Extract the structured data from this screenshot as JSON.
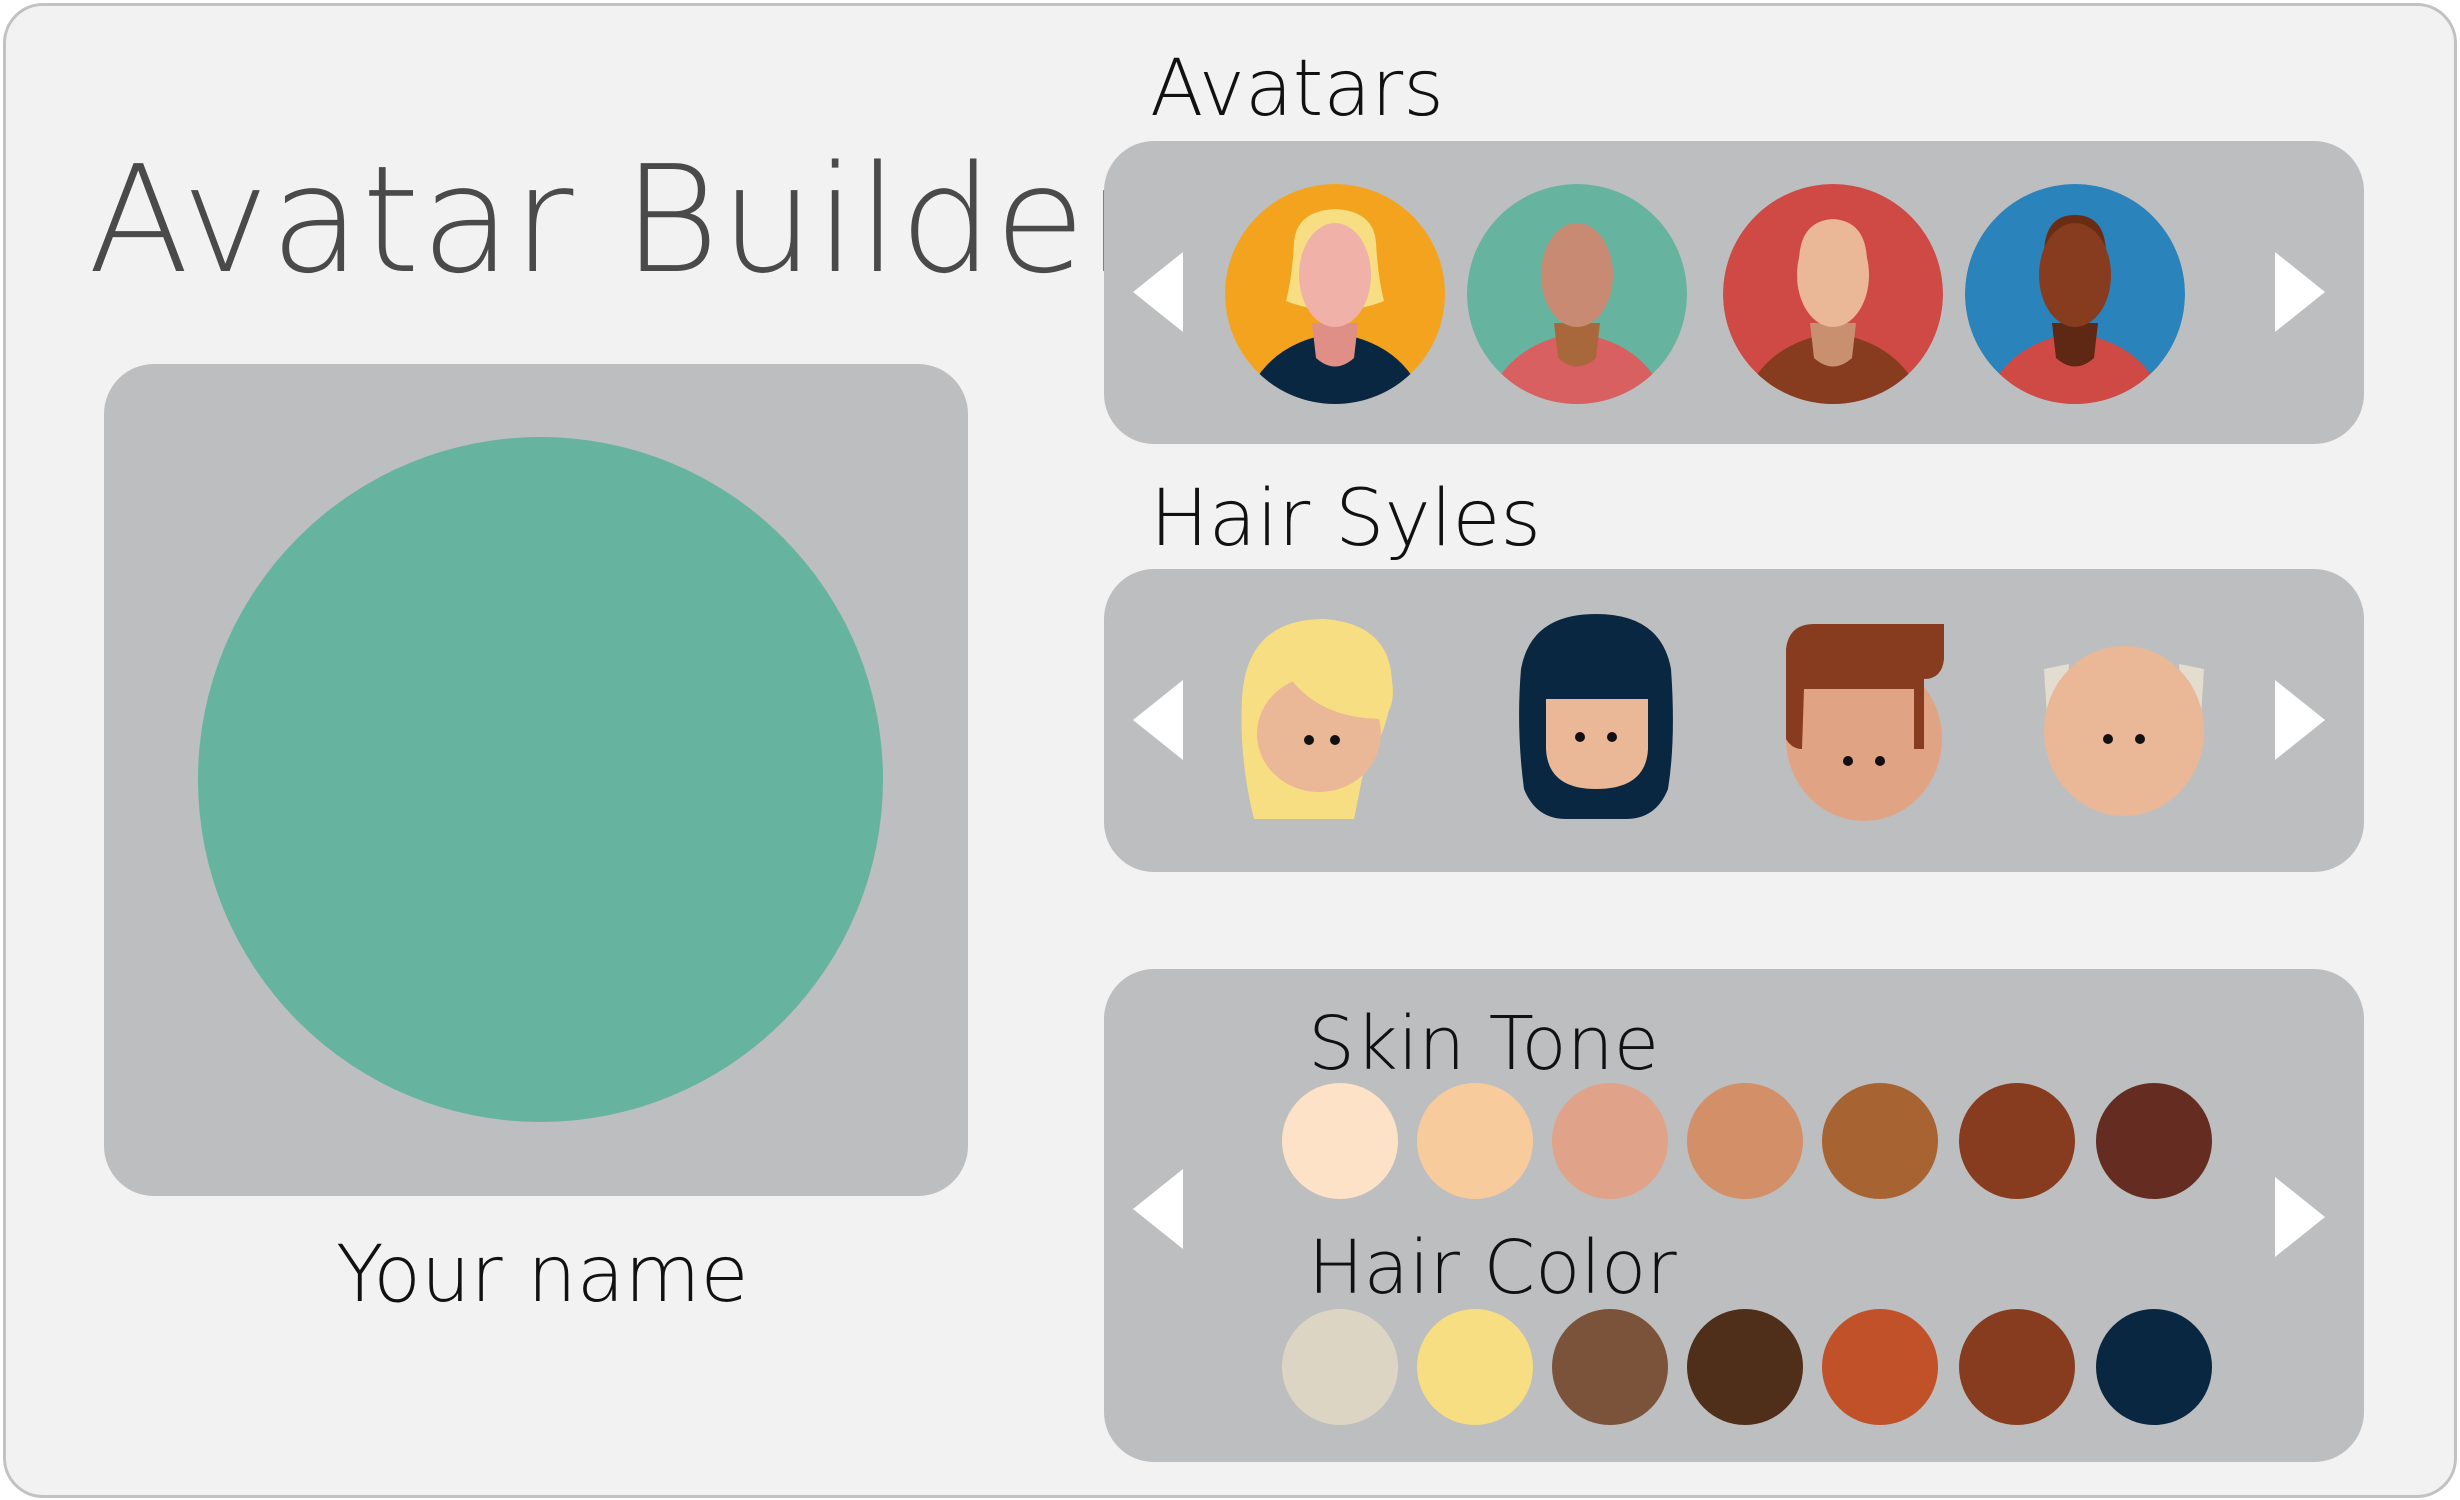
{
  "title": "Avatar Builder",
  "preview": {
    "circle_color": "#66b3a0",
    "name_label": "Your name"
  },
  "sections": {
    "avatars": {
      "label": "Avatars",
      "items": [
        {
          "name": "avatar-blonde-woman",
          "bg": "#f4a31e",
          "skin": "#f0b1a8",
          "hair": "#f4a31e",
          "shirt": "#0a2741",
          "neck": "#e08f86"
        },
        {
          "name": "avatar-bald-man",
          "bg": "#66b3a0",
          "skin": "#c88a72",
          "hair": "#c88a72",
          "shirt": "#d86060",
          "neck": "#a8683b"
        },
        {
          "name": "avatar-light-man",
          "bg": "#d04a45",
          "skin": "#eab896",
          "hair": "#eab896",
          "shirt": "#883c1f",
          "neck": "#c8906e"
        },
        {
          "name": "avatar-dark-man",
          "bg": "#2a83ba",
          "skin": "#883c1f",
          "hair": "#6a2d14",
          "shirt": "#d04a45",
          "neck": "#5e2814"
        }
      ]
    },
    "hair_styles": {
      "label": "Hair Syles",
      "items": [
        {
          "name": "hair-style-long-blonde",
          "hair": "#f7de82",
          "skin": "#eab896"
        },
        {
          "name": "hair-style-navy-bob",
          "hair": "#0a2741",
          "skin": "#eab896"
        },
        {
          "name": "hair-style-brown-quiff",
          "hair": "#883c1f",
          "skin": "#e0a384"
        },
        {
          "name": "hair-style-bald-grey",
          "hair": "#e3ddd0",
          "skin": "#eab896"
        }
      ]
    },
    "colors": {
      "skin_label": "Skin Tone",
      "hair_label": "Hair Color",
      "skin_tones": [
        "#fde2c8",
        "#f8cb9d",
        "#e0a38a",
        "#d28f68",
        "#a86333",
        "#883c1f",
        "#652d22"
      ],
      "hair_colors": [
        "#ddd5c4",
        "#f7de82",
        "#7b523a",
        "#4f2e1a",
        "#c05129",
        "#883c1f",
        "#0a2741"
      ]
    }
  }
}
